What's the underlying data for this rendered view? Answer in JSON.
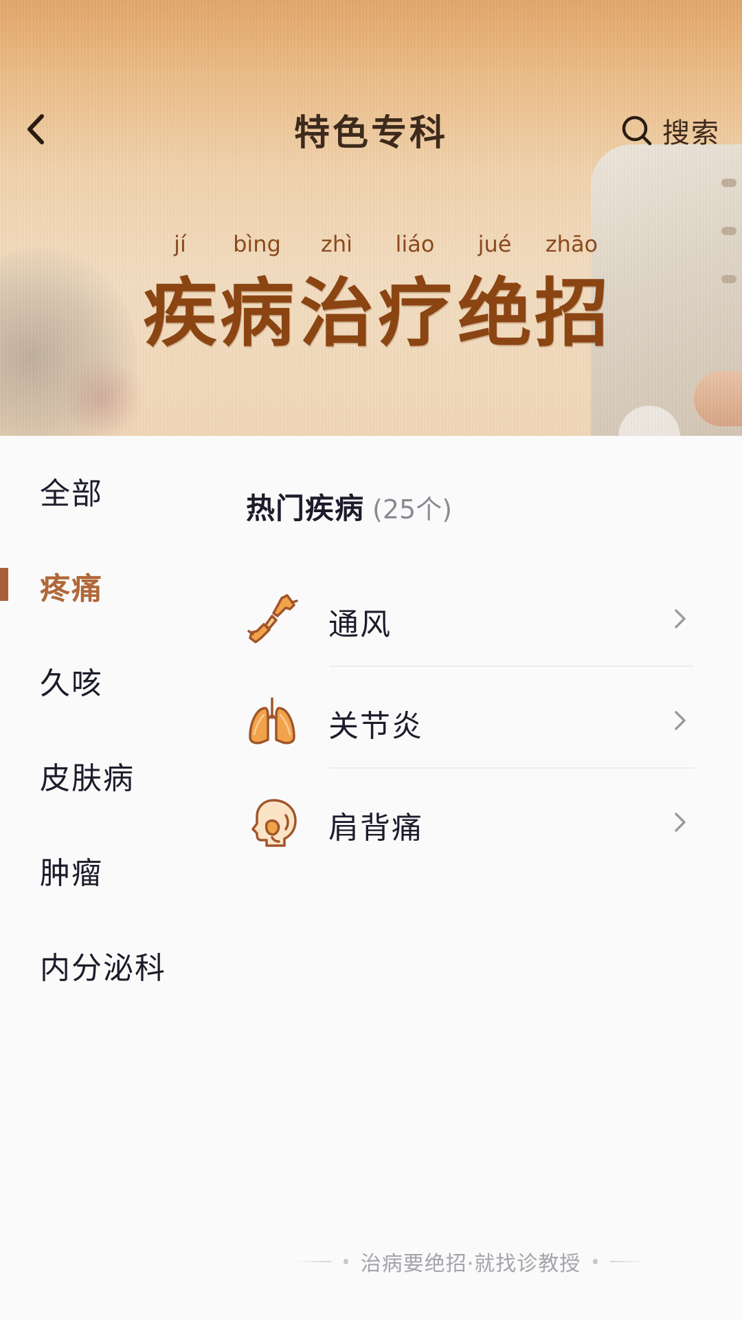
{
  "header": {
    "title": "特色专科",
    "search_label": "搜索",
    "back_icon": "chevron-left-icon",
    "search_icon": "search-icon"
  },
  "banner": {
    "pinyin": [
      "jí",
      "bìng",
      "zhì",
      "liáo",
      "jué",
      "zhāo"
    ],
    "headline_chars": [
      "疾",
      "病",
      "治",
      "疗",
      "绝",
      "招"
    ]
  },
  "sidebar": {
    "items": [
      {
        "label": "全部",
        "active": false
      },
      {
        "label": "疼痛",
        "active": true
      },
      {
        "label": "久咳",
        "active": false
      },
      {
        "label": "皮肤病",
        "active": false
      },
      {
        "label": "肿瘤",
        "active": false
      },
      {
        "label": "内分泌科",
        "active": false
      }
    ]
  },
  "content": {
    "section_title": "热门疾病",
    "section_count": "(25个)",
    "diseases": [
      {
        "name": "通风",
        "icon": "joint-bone-icon"
      },
      {
        "name": "关节炎",
        "icon": "lungs-icon"
      },
      {
        "name": "肩背痛",
        "icon": "head-profile-icon"
      }
    ]
  },
  "footer": {
    "slogan": "治病要绝招·就找诊教授"
  },
  "colors": {
    "accent": "#b0683a",
    "headline": "#8b4513",
    "text_primary": "#1c1c2b",
    "text_muted": "#8a8a93",
    "icon_orange": "#e8963a"
  }
}
